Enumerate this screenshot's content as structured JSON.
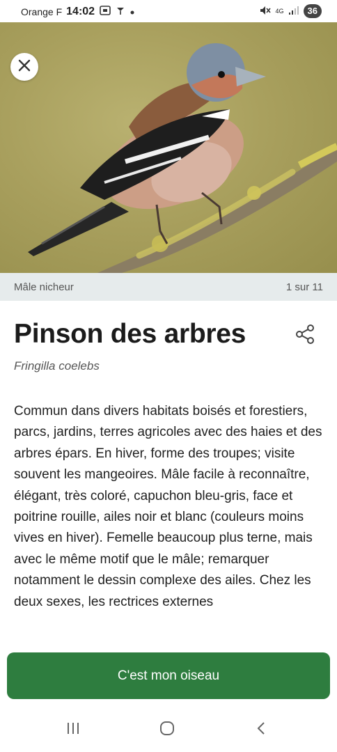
{
  "status_bar": {
    "carrier": "Orange F",
    "time": "14:02",
    "network": "4G",
    "battery": "36"
  },
  "photo": {
    "caption": "Mâle nicheur",
    "counter": "1 sur 11"
  },
  "species": {
    "name": "Pinson des arbres",
    "latin": "Fringilla coelebs",
    "description": "Commun dans divers habitats boisés et forestiers, parcs, jardins, terres agricoles avec des haies et des arbres épars. En hiver, forme des troupes; visite souvent les mangeoires. Mâle facile à reconnaître, élégant, très coloré, capuchon bleu-gris, face et poitrine rouille, ailes noir et blanc (couleurs moins vives en hiver). Femelle beaucoup plus terne, mais avec le même motif que le mâle; remarquer notamment le dessin complexe des ailes. Chez les deux sexes, les rectrices externes"
  },
  "actions": {
    "confirm_label": "C'est mon oiseau"
  },
  "icons": [
    "close-icon",
    "share-icon",
    "recent-apps-icon",
    "home-icon",
    "back-icon"
  ],
  "colors": {
    "accent": "#2e7d3f",
    "caption_bar": "#e6ebec"
  }
}
